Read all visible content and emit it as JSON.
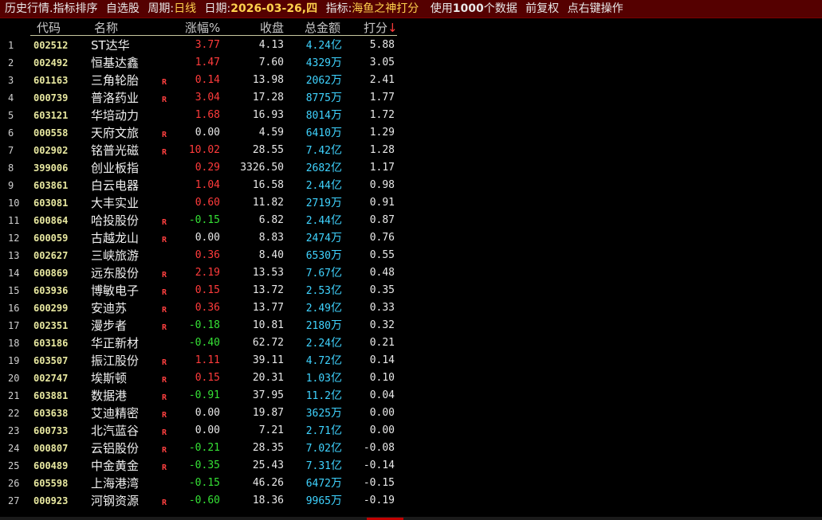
{
  "title": {
    "history": "历史行情",
    "separator": ".",
    "sort": "指标排序",
    "pool": "自选股",
    "period_key": "周期:",
    "period_val": "日线",
    "date_key": "日期:",
    "date_val": "2026-03-26,四",
    "indicator_key": "指标:",
    "indicator_val": "海鱼之神打分",
    "use_pre": "使用",
    "use_count": "1000",
    "use_post": "个数据",
    "adjust": "前复权",
    "hint": "点右键操作"
  },
  "headers": {
    "code": "代码",
    "name": "名称",
    "change": "涨幅%",
    "close": "收盘",
    "amount": "总金额",
    "score": "打分",
    "sort_arrow": "↓"
  },
  "rows": [
    {
      "idx": "1",
      "code": "002512",
      "name": "ST达华",
      "r": "",
      "chg": "3.77",
      "dir": "up",
      "close": "4.13",
      "amt": "4.24",
      "unit": "亿",
      "score": "5.88"
    },
    {
      "idx": "2",
      "code": "002492",
      "name": "恒基达鑫",
      "r": "",
      "chg": "1.47",
      "dir": "up",
      "close": "7.60",
      "amt": "4329",
      "unit": "万",
      "score": "3.05"
    },
    {
      "idx": "3",
      "code": "601163",
      "name": "三角轮胎",
      "r": "R",
      "chg": "0.14",
      "dir": "up",
      "close": "13.98",
      "amt": "2062",
      "unit": "万",
      "score": "2.41"
    },
    {
      "idx": "4",
      "code": "000739",
      "name": "普洛药业",
      "r": "R",
      "chg": "3.04",
      "dir": "up",
      "close": "17.28",
      "amt": "8775",
      "unit": "万",
      "score": "1.77"
    },
    {
      "idx": "5",
      "code": "603121",
      "name": "华培动力",
      "r": "",
      "chg": "1.68",
      "dir": "up",
      "close": "16.93",
      "amt": "8014",
      "unit": "万",
      "score": "1.72"
    },
    {
      "idx": "6",
      "code": "000558",
      "name": "天府文旅",
      "r": "R",
      "chg": "0.00",
      "dir": "flat",
      "close": "4.59",
      "amt": "6410",
      "unit": "万",
      "score": "1.29"
    },
    {
      "idx": "7",
      "code": "002902",
      "name": "铭普光磁",
      "r": "R",
      "chg": "10.02",
      "dir": "up",
      "close": "28.55",
      "amt": "7.42",
      "unit": "亿",
      "score": "1.28"
    },
    {
      "idx": "8",
      "code": "399006",
      "name": "创业板指",
      "r": "",
      "chg": "0.29",
      "dir": "up",
      "close": "3326.50",
      "amt": "2682",
      "unit": "亿",
      "score": "1.17"
    },
    {
      "idx": "9",
      "code": "603861",
      "name": "白云电器",
      "r": "",
      "chg": "1.04",
      "dir": "up",
      "close": "16.58",
      "amt": "2.44",
      "unit": "亿",
      "score": "0.98"
    },
    {
      "idx": "10",
      "code": "603081",
      "name": "大丰实业",
      "r": "",
      "chg": "0.60",
      "dir": "up",
      "close": "11.82",
      "amt": "2719",
      "unit": "万",
      "score": "0.91"
    },
    {
      "idx": "11",
      "code": "600864",
      "name": "哈投股份",
      "r": "R",
      "chg": "-0.15",
      "dir": "down",
      "close": "6.82",
      "amt": "2.44",
      "unit": "亿",
      "score": "0.87"
    },
    {
      "idx": "12",
      "code": "600059",
      "name": "古越龙山",
      "r": "R",
      "chg": "0.00",
      "dir": "flat",
      "close": "8.83",
      "amt": "2474",
      "unit": "万",
      "score": "0.76"
    },
    {
      "idx": "13",
      "code": "002627",
      "name": "三峡旅游",
      "r": "",
      "chg": "0.36",
      "dir": "up",
      "close": "8.40",
      "amt": "6530",
      "unit": "万",
      "score": "0.55"
    },
    {
      "idx": "14",
      "code": "600869",
      "name": "远东股份",
      "r": "R",
      "chg": "2.19",
      "dir": "up",
      "close": "13.53",
      "amt": "7.67",
      "unit": "亿",
      "score": "0.48"
    },
    {
      "idx": "15",
      "code": "603936",
      "name": "博敏电子",
      "r": "R",
      "chg": "0.15",
      "dir": "up",
      "close": "13.72",
      "amt": "2.53",
      "unit": "亿",
      "score": "0.35"
    },
    {
      "idx": "16",
      "code": "600299",
      "name": "安迪苏",
      "r": "R",
      "chg": "0.36",
      "dir": "up",
      "close": "13.77",
      "amt": "2.49",
      "unit": "亿",
      "score": "0.33"
    },
    {
      "idx": "17",
      "code": "002351",
      "name": "漫步者",
      "r": "R",
      "chg": "-0.18",
      "dir": "down",
      "close": "10.81",
      "amt": "2180",
      "unit": "万",
      "score": "0.32"
    },
    {
      "idx": "18",
      "code": "603186",
      "name": "华正新材",
      "r": "",
      "chg": "-0.40",
      "dir": "down",
      "close": "62.72",
      "amt": "2.24",
      "unit": "亿",
      "score": "0.21"
    },
    {
      "idx": "19",
      "code": "603507",
      "name": "振江股份",
      "r": "R",
      "chg": "1.11",
      "dir": "up",
      "close": "39.11",
      "amt": "4.72",
      "unit": "亿",
      "score": "0.14"
    },
    {
      "idx": "20",
      "code": "002747",
      "name": "埃斯顿",
      "r": "R",
      "chg": "0.15",
      "dir": "up",
      "close": "20.31",
      "amt": "1.03",
      "unit": "亿",
      "score": "0.10"
    },
    {
      "idx": "21",
      "code": "603881",
      "name": "数据港",
      "r": "R",
      "chg": "-0.91",
      "dir": "down",
      "close": "37.95",
      "amt": "11.2",
      "unit": "亿",
      "score": "0.04"
    },
    {
      "idx": "22",
      "code": "603638",
      "name": "艾迪精密",
      "r": "R",
      "chg": "0.00",
      "dir": "flat",
      "close": "19.87",
      "amt": "3625",
      "unit": "万",
      "score": "0.00"
    },
    {
      "idx": "23",
      "code": "600733",
      "name": "北汽蓝谷",
      "r": "R",
      "chg": "0.00",
      "dir": "flat",
      "close": "7.21",
      "amt": "2.71",
      "unit": "亿",
      "score": "0.00"
    },
    {
      "idx": "24",
      "code": "000807",
      "name": "云铝股份",
      "r": "R",
      "chg": "-0.21",
      "dir": "down",
      "close": "28.35",
      "amt": "7.02",
      "unit": "亿",
      "score": "-0.08"
    },
    {
      "idx": "25",
      "code": "600489",
      "name": "中金黄金",
      "r": "R",
      "chg": "-0.35",
      "dir": "down",
      "close": "25.43",
      "amt": "7.31",
      "unit": "亿",
      "score": "-0.14"
    },
    {
      "idx": "26",
      "code": "605598",
      "name": "上海港湾",
      "r": "",
      "chg": "-0.15",
      "dir": "down",
      "close": "46.26",
      "amt": "6472",
      "unit": "万",
      "score": "-0.15"
    },
    {
      "idx": "27",
      "code": "000923",
      "name": "河钢资源",
      "r": "R",
      "chg": "-0.60",
      "dir": "down",
      "close": "18.36",
      "amt": "9965",
      "unit": "万",
      "score": "-0.19"
    }
  ],
  "colors": {
    "up": "#ff3b3b",
    "down": "#35e035",
    "amount": "#3fd3ff",
    "titlebar": "#550000"
  }
}
